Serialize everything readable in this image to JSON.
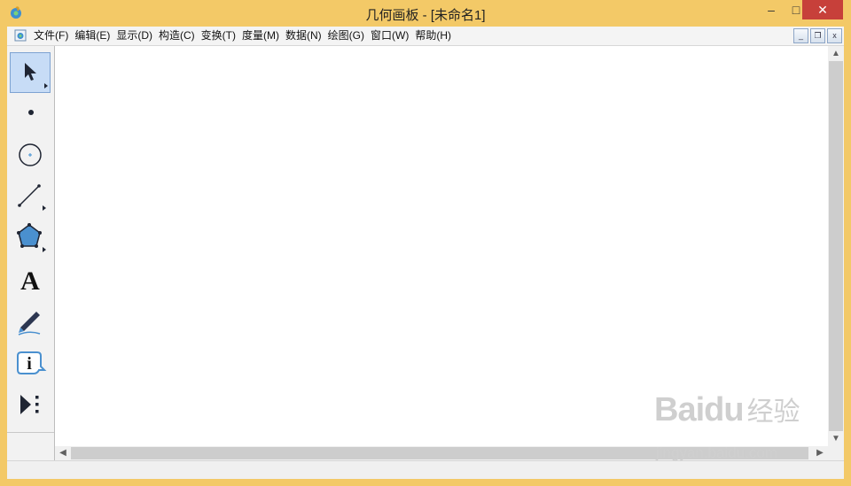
{
  "window": {
    "title": "几何画板 - [未命名1]",
    "controls": {
      "minimize": "–",
      "maximize": "□",
      "close": "✕"
    }
  },
  "menubar": {
    "items": [
      {
        "label": "文件(F)"
      },
      {
        "label": "编辑(E)"
      },
      {
        "label": "显示(D)"
      },
      {
        "label": "构造(C)"
      },
      {
        "label": "变换(T)"
      },
      {
        "label": "度量(M)"
      },
      {
        "label": "数据(N)"
      },
      {
        "label": "绘图(G)"
      },
      {
        "label": "窗口(W)"
      },
      {
        "label": "帮助(H)"
      }
    ],
    "mdi_controls": {
      "minimize": "_",
      "restore": "❐",
      "close": "x"
    }
  },
  "toolbox": {
    "tools": [
      {
        "name": "selection-arrow-tool",
        "icon": "arrow-icon",
        "active": true
      },
      {
        "name": "point-tool",
        "icon": "point-icon",
        "active": false
      },
      {
        "name": "compass-tool",
        "icon": "circle-icon",
        "active": false
      },
      {
        "name": "straightedge-tool",
        "icon": "segment-icon",
        "active": false
      },
      {
        "name": "polygon-tool",
        "icon": "polygon-icon",
        "active": false
      },
      {
        "name": "text-tool",
        "icon": "text-A-icon",
        "glyph": "A",
        "active": false
      },
      {
        "name": "marker-tool",
        "icon": "marker-pen-icon",
        "active": false
      },
      {
        "name": "information-tool",
        "icon": "info-icon",
        "glyph": "i",
        "active": false
      },
      {
        "name": "custom-tool",
        "icon": "play-custom-icon",
        "active": false
      }
    ]
  },
  "scrollbars": {
    "up": "▲",
    "down": "▼",
    "left": "◀",
    "right": "▶"
  },
  "watermark": {
    "logo": "Baidu",
    "text": "经验",
    "url": "jingyan.baidu.com"
  },
  "colors": {
    "title_bar": "#f3c967",
    "close_button": "#c7403a",
    "active_tool": "#c7dcf6",
    "canvas": "#ffffff"
  }
}
